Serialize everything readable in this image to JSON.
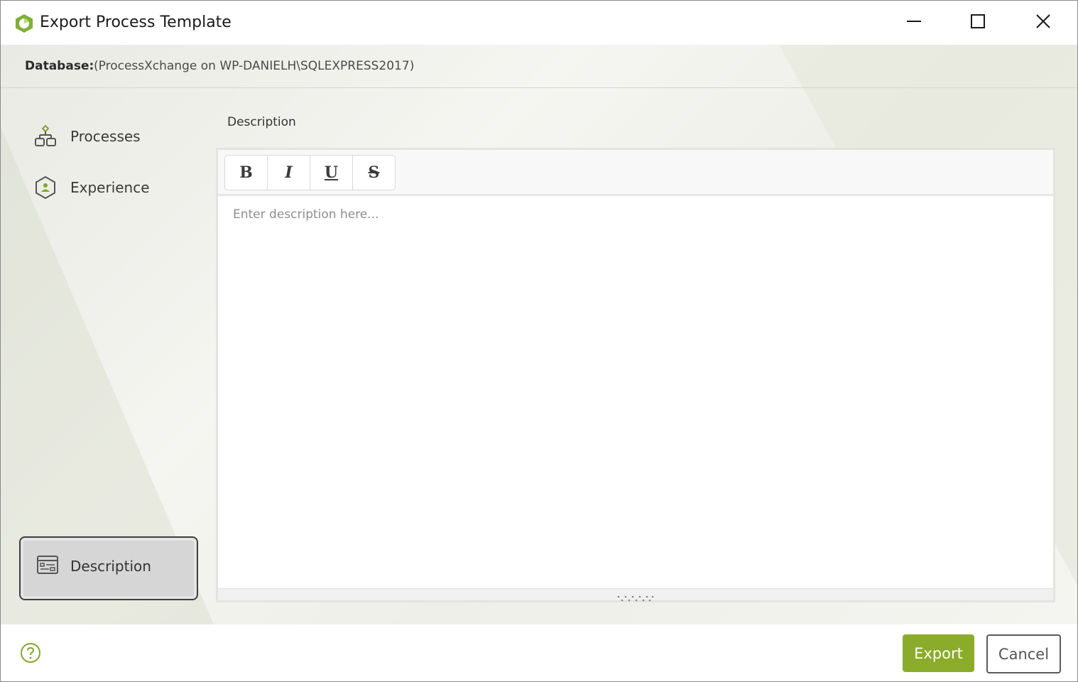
{
  "window": {
    "title": "Export Process Template",
    "controls": {
      "minimize_icon": "minimize-icon",
      "maximize_icon": "maximize-icon",
      "close_icon": "close-icon"
    }
  },
  "database": {
    "label": "Database:",
    "value": "(ProcessXchange on WP-DANIELH\\SQLEXPRESS2017)"
  },
  "sidebar": {
    "items": [
      {
        "label": "Processes",
        "icon": "processes-icon",
        "selected": false
      },
      {
        "label": "Experience",
        "icon": "experience-icon",
        "selected": false
      },
      {
        "label": "Description",
        "icon": "description-icon",
        "selected": true
      }
    ]
  },
  "editor": {
    "heading": "Description",
    "toolbar": {
      "bold": "B",
      "italic": "I",
      "underline": "U",
      "strikethrough": "S"
    },
    "placeholder": "Enter description here..."
  },
  "footer": {
    "help_icon": "help-icon",
    "export_label": "Export",
    "cancel_label": "Cancel"
  },
  "colors": {
    "accent": "#8aac2a",
    "logo": "#7fb03a"
  }
}
